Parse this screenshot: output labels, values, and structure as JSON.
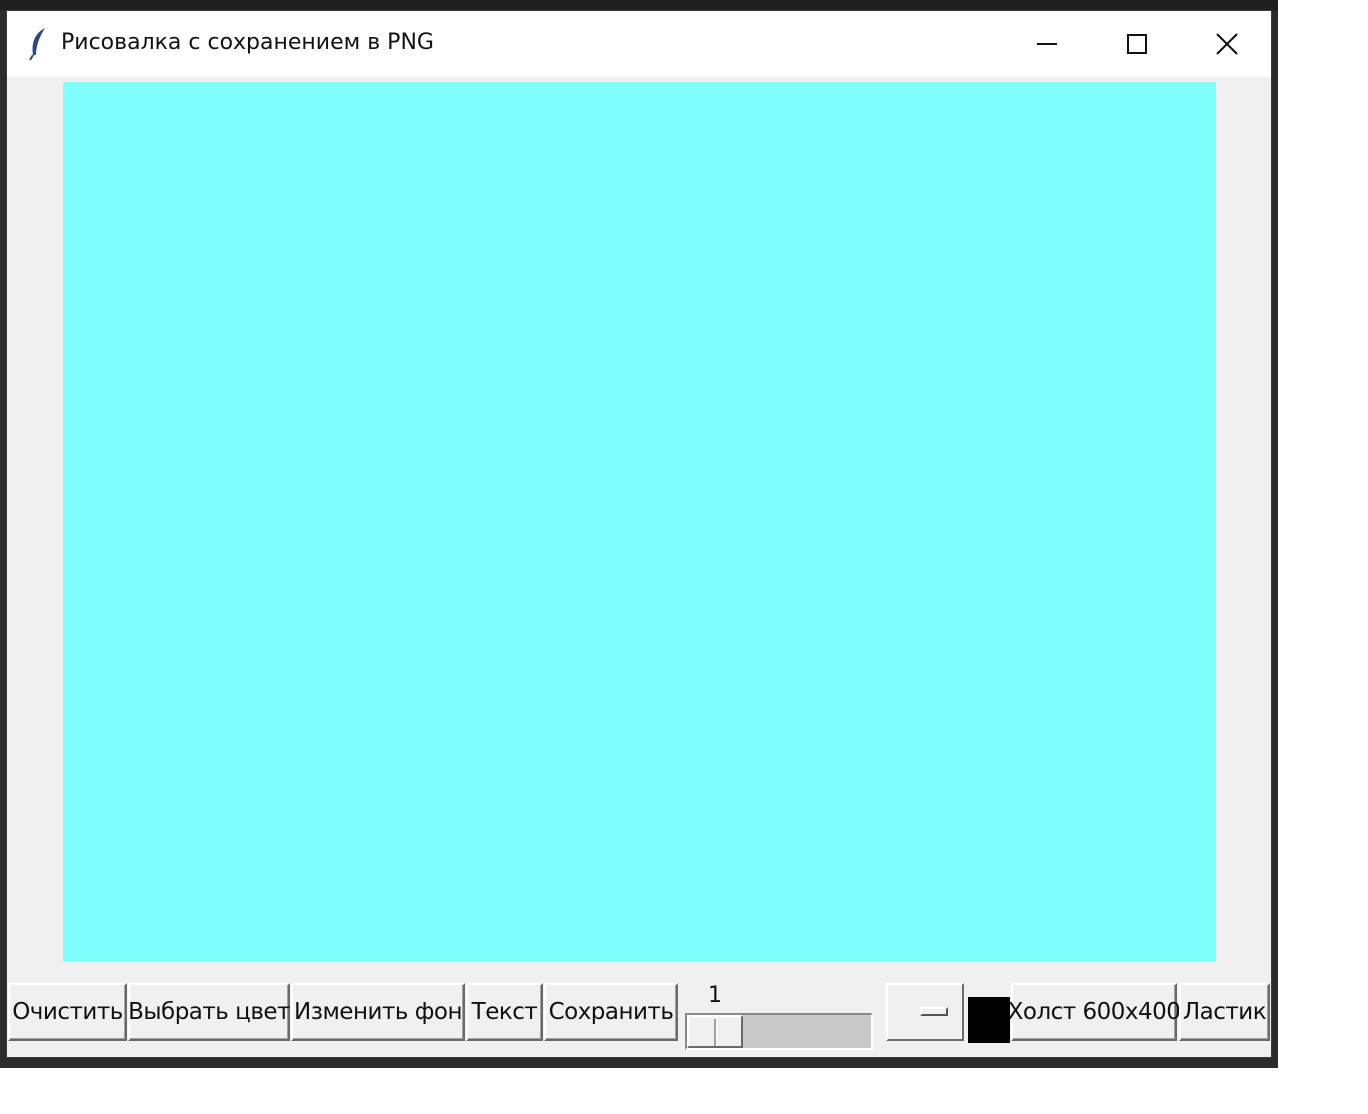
{
  "window": {
    "title": "Рисовалка с сохранением в PNG",
    "icon": "feather-icon",
    "controls": [
      "minimize-icon",
      "maximize-icon",
      "close-icon"
    ]
  },
  "canvas": {
    "background_color": "#80ffff"
  },
  "toolbar": {
    "clear_label": "Очистить",
    "pick_color_label": "Выбрать цвет",
    "change_bg_label": "Изменить фон",
    "text_label": "Текст",
    "save_label": "Сохранить",
    "brush_size_value": "1",
    "current_color": "#000000",
    "canvas_size_label": "Холст 600x400",
    "eraser_label": "Ластик"
  }
}
